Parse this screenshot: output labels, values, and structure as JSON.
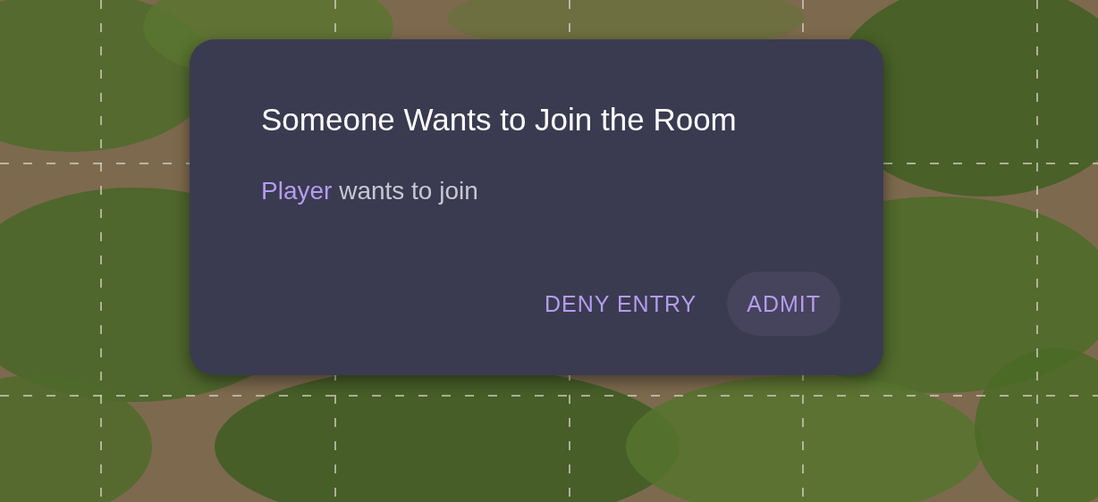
{
  "dialog": {
    "title": "Someone Wants to Join the Room",
    "message": {
      "name": "Player",
      "text": "wants to join"
    },
    "buttons": [
      {
        "label": "DENY ENTRY",
        "kind": "text"
      },
      {
        "label": "ADMIT",
        "kind": "tonal"
      }
    ]
  }
}
